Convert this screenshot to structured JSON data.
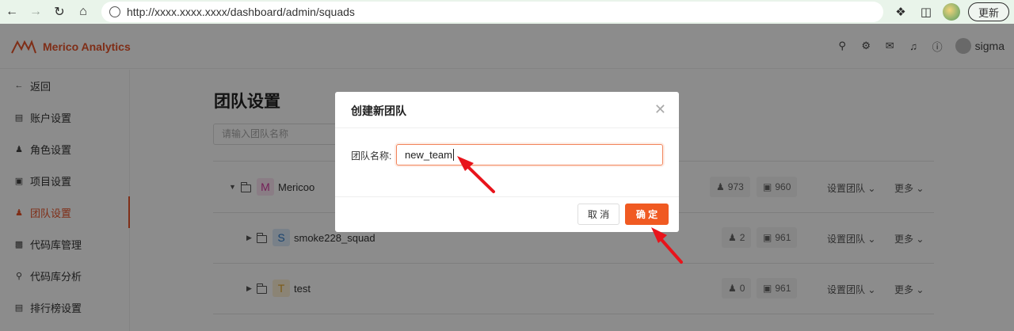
{
  "browser": {
    "url": "http://xxxx.xxxx.xxxx/dashboard/admin/squads",
    "update_label": "更新"
  },
  "header": {
    "brand": "Merico Analytics",
    "user_name": "sigma"
  },
  "sidebar": {
    "items": [
      {
        "label": "返回",
        "icon": "arrow-left-icon"
      },
      {
        "label": "账户设置",
        "icon": "id-card-icon"
      },
      {
        "label": "角色设置",
        "icon": "user-icon"
      },
      {
        "label": "项目设置",
        "icon": "project-icon"
      },
      {
        "label": "团队设置",
        "icon": "team-icon",
        "active": true
      },
      {
        "label": "代码库管理",
        "icon": "repo-icon"
      },
      {
        "label": "代码库分析",
        "icon": "analysis-icon"
      },
      {
        "label": "排行榜设置",
        "icon": "leaderboard-icon"
      }
    ]
  },
  "main": {
    "title": "团队设置",
    "search_placeholder": "请输入团队名称",
    "rows": [
      {
        "avatar": "M",
        "name": "Mericoo",
        "members": "973",
        "repos": "960",
        "setting": "设置团队",
        "more": "更多"
      },
      {
        "avatar": "S",
        "name": "smoke228_squad",
        "members": "2",
        "repos": "961",
        "setting": "设置团队",
        "more": "更多"
      },
      {
        "avatar": "T",
        "name": "test",
        "members": "0",
        "repos": "961",
        "setting": "设置团队",
        "more": "更多"
      }
    ]
  },
  "modal": {
    "title": "创建新团队",
    "field_label": "团队名称:",
    "field_value": "new_team",
    "cancel_label": "取 消",
    "ok_label": "确 定"
  },
  "colors": {
    "accent": "#e8542a",
    "primary_button": "#f05a22",
    "annotation_arrow": "#e8141b"
  }
}
